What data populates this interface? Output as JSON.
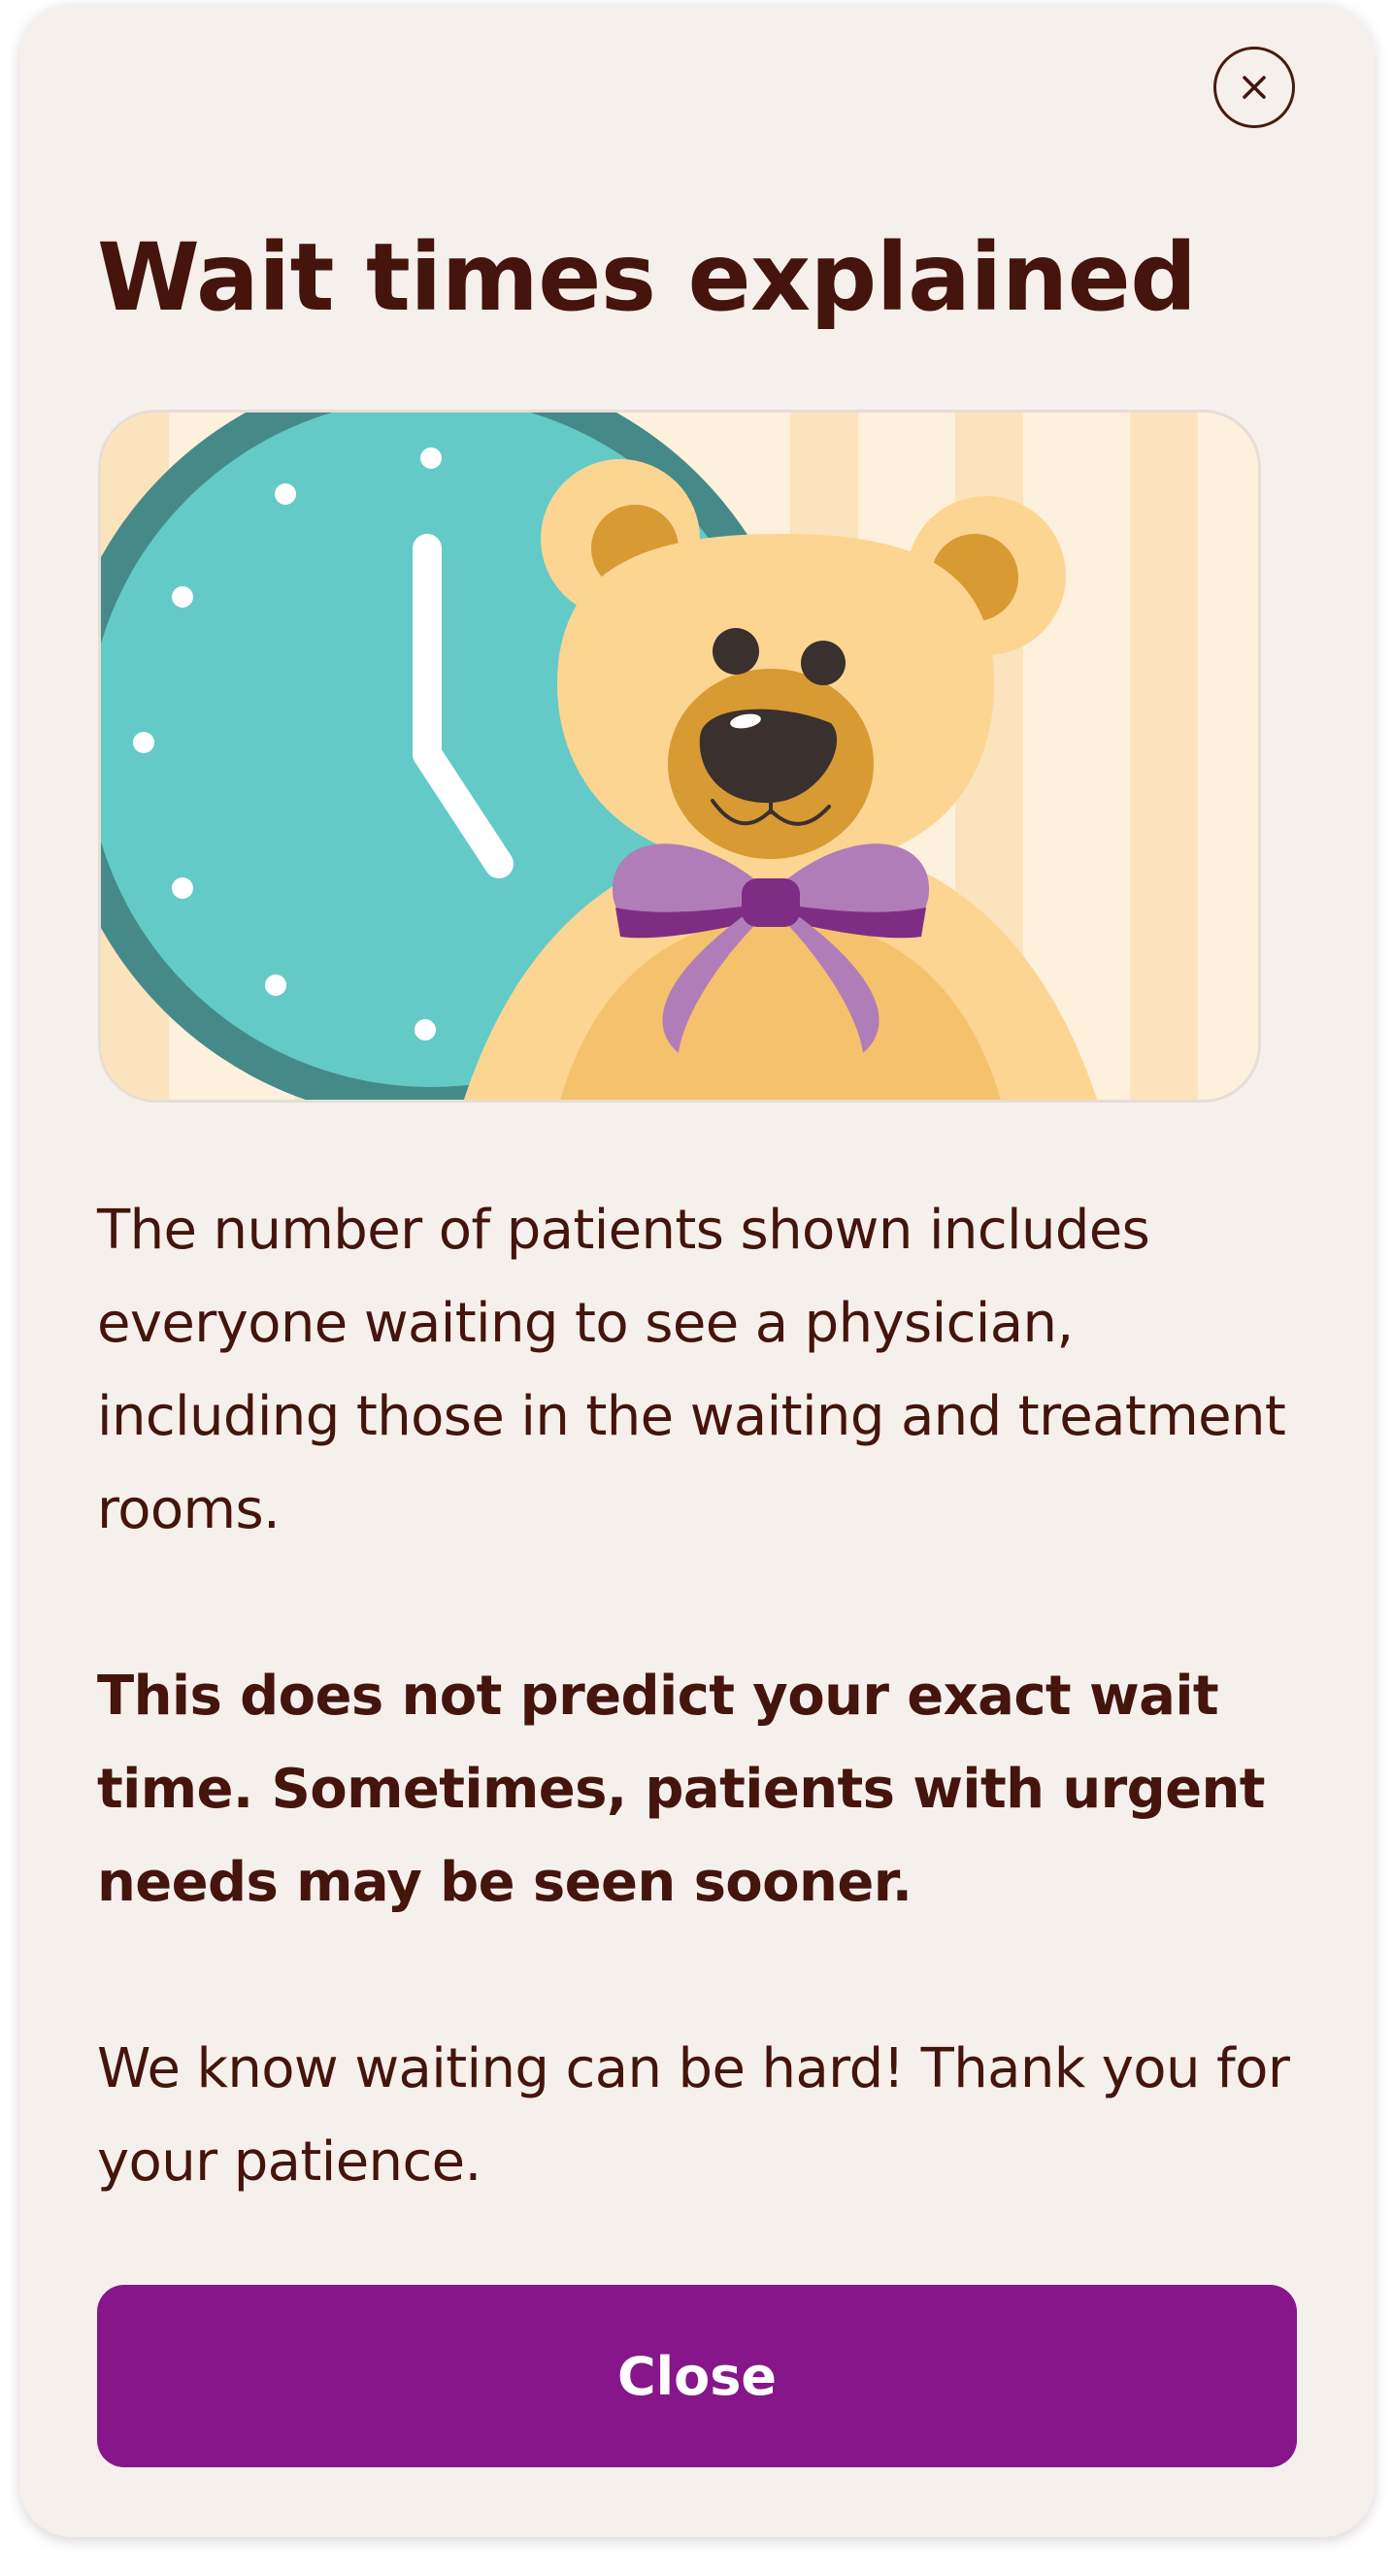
{
  "dialog": {
    "title": "Wait times explained",
    "paragraph_1": "The number of patients shown includes everyone waiting to see a physician, including those in the waiting and treatment rooms.",
    "paragraph_2": "This does not predict your exact wait time. Sometimes, patients with urgent needs may be seen sooner.",
    "paragraph_3": "We know waiting can be hard! Thank you for your patience.",
    "close_button_label": "Close",
    "close_icon": "close-icon"
  },
  "illustration": {
    "subject": "teddy bear in front of a wall clock",
    "clock_time_shown": "5:00"
  },
  "colors": {
    "background": "#f5f0ec",
    "text": "#45140c",
    "primary_button": "#86168a",
    "clock_face": "#63cac7",
    "clock_rim": "#458a88",
    "bear_fur": "#fcd592",
    "bow": "#b07db8"
  }
}
